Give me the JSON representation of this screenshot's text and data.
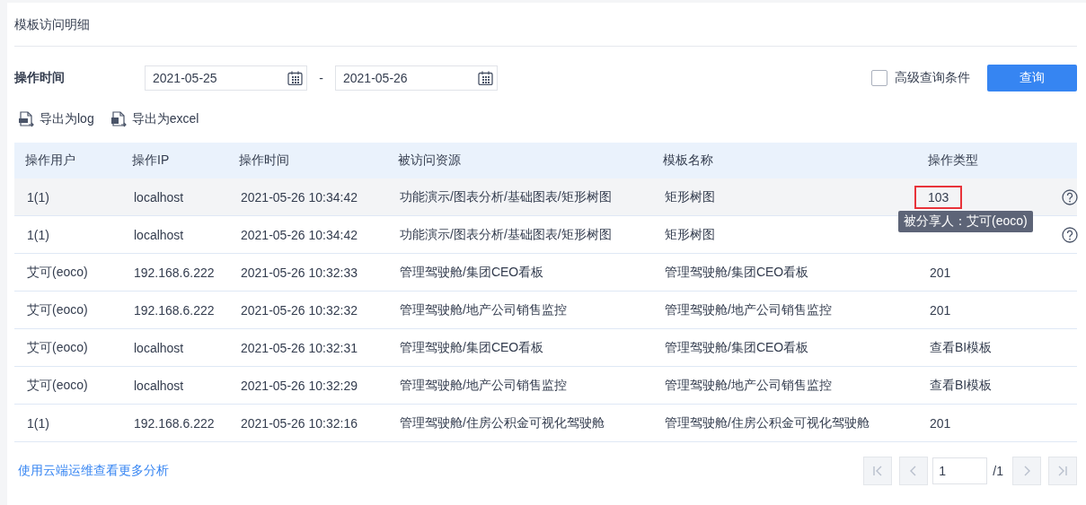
{
  "panel": {
    "title": "模板访问明细"
  },
  "filter": {
    "label": "操作时间",
    "start_date": "2021-05-25",
    "separator": "-",
    "end_date": "2021-05-26",
    "advanced": {
      "label": "高级查询条件",
      "checked": false
    },
    "query_button": "查询"
  },
  "exports": [
    {
      "label": "导出为log",
      "kind": "log"
    },
    {
      "label": "导出为excel",
      "kind": "excel"
    }
  ],
  "table": {
    "columns": [
      "操作用户",
      "操作IP",
      "操作时间",
      "被访问资源",
      "模板名称",
      "操作类型"
    ],
    "rows": [
      {
        "cells": [
          "1(1)",
          "localhost",
          "2021-05-26 10:34:42",
          "功能演示/图表分析/基础图表/矩形树图",
          "矩形树图",
          "103"
        ],
        "highlighted": true,
        "marked": true,
        "help": true
      },
      {
        "cells": [
          "1(1)",
          "localhost",
          "2021-05-26 10:34:42",
          "功能演示/图表分析/基础图表/矩形树图",
          "矩形树图"
        ],
        "highlighted": false,
        "help": true
      },
      {
        "cells": [
          "艾可(eoco)",
          "192.168.6.222",
          "2021-05-26 10:32:33",
          "管理驾驶舱/集团CEO看板",
          "管理驾驶舱/集团CEO看板",
          "201"
        ],
        "highlighted": false,
        "help": false
      },
      {
        "cells": [
          "艾可(eoco)",
          "192.168.6.222",
          "2021-05-26 10:32:32",
          "管理驾驶舱/地产公司销售监控",
          "管理驾驶舱/地产公司销售监控",
          "201"
        ],
        "highlighted": false,
        "help": false
      },
      {
        "cells": [
          "艾可(eoco)",
          "localhost",
          "2021-05-26 10:32:31",
          "管理驾驶舱/集团CEO看板",
          "管理驾驶舱/集团CEO看板",
          "查看BI模板"
        ],
        "highlighted": false,
        "help": false
      },
      {
        "cells": [
          "艾可(eoco)",
          "localhost",
          "2021-05-26 10:32:29",
          "管理驾驶舱/地产公司销售监控",
          "管理驾驶舱/地产公司销售监控",
          "查看BI模板"
        ],
        "highlighted": false,
        "help": false
      },
      {
        "cells": [
          "1(1)",
          "192.168.6.222",
          "2021-05-26 10:32:16",
          "管理驾驶舱/住房公积金可视化驾驶舱",
          "管理驾驶舱/住房公积金可视化驾驶舱",
          "201"
        ],
        "highlighted": false,
        "help": false
      }
    ],
    "tooltip": "被分享人：艾可(eoco)"
  },
  "footer": {
    "link": "使用云端运维查看更多分析",
    "pagination": {
      "page": "1",
      "total": "/1"
    }
  }
}
